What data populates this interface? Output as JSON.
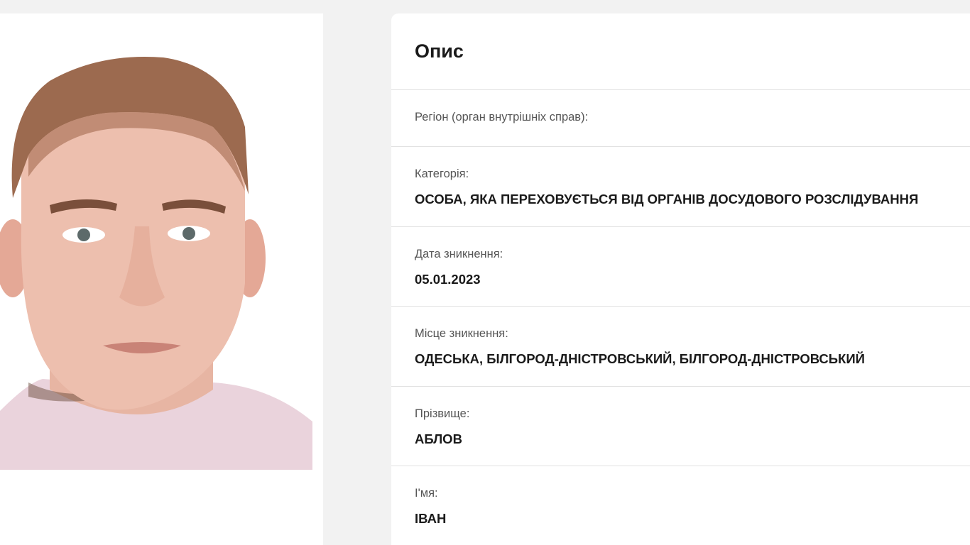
{
  "description": {
    "title": "Опис",
    "fields": [
      {
        "label": "Регіон (орган внутрішніх справ):",
        "value": ""
      },
      {
        "label": "Категорія:",
        "value": "ОСОБА, ЯКА ПЕРЕХОВУЄТЬСЯ ВІД ОРГАНІВ ДОСУДОВОГО РОЗСЛІДУВАННЯ"
      },
      {
        "label": "Дата зникнення:",
        "value": "05.01.2023"
      },
      {
        "label": "Місце зникнення:",
        "value": "ОДЕСЬКА, БІЛГОРОД-ДНІСТРОВСЬКИЙ, БІЛГОРОД-ДНІСТРОВСЬКИЙ"
      },
      {
        "label": "Прізвище:",
        "value": "АБЛОВ"
      },
      {
        "label": "І'мя:",
        "value": "ІВАН"
      }
    ]
  },
  "colors": {
    "page_background": "#f2f2f2",
    "card_background": "#ffffff",
    "divider": "#e2e2e2",
    "label_text": "#555555",
    "value_text": "#1a1a1a"
  }
}
